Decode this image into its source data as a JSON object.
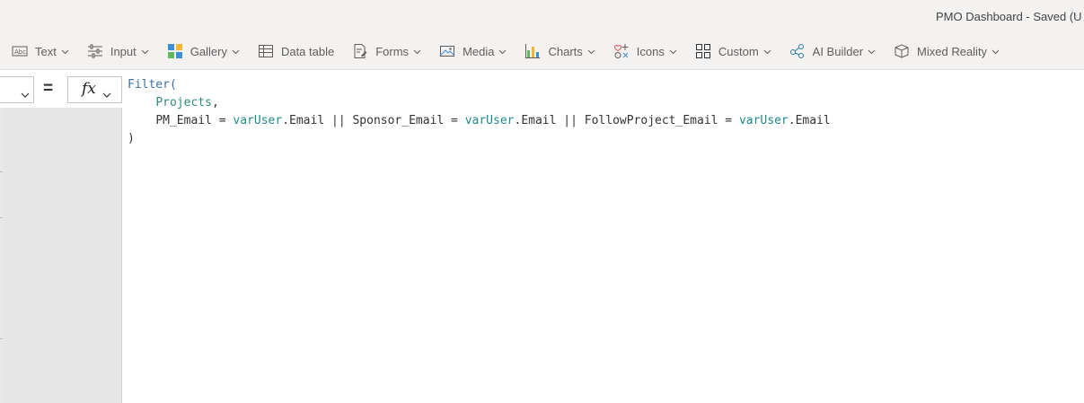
{
  "window": {
    "title": "PMO Dashboard - Saved (U"
  },
  "toolbar": {
    "items": [
      {
        "label": "Text",
        "icon": "text-label-icon"
      },
      {
        "label": "Input",
        "icon": "input-sliders-icon"
      },
      {
        "label": "Gallery",
        "icon": "gallery-icon"
      },
      {
        "label": "Data table",
        "icon": "data-table-icon"
      },
      {
        "label": "Forms",
        "icon": "forms-icon"
      },
      {
        "label": "Media",
        "icon": "media-icon"
      },
      {
        "label": "Charts",
        "icon": "charts-icon"
      },
      {
        "label": "Icons",
        "icon": "icons-icon"
      },
      {
        "label": "Custom",
        "icon": "custom-icon"
      },
      {
        "label": "AI Builder",
        "icon": "ai-builder-icon"
      },
      {
        "label": "Mixed Reality",
        "icon": "mixed-reality-icon"
      }
    ]
  },
  "formula_bar": {
    "equals": "=",
    "fx": "fx",
    "code": {
      "line1_fn": "Filter(",
      "line2_indent": "    ",
      "line2_source": "Projects",
      "line2_comma": ",",
      "line3_indent": "    ",
      "line3_a": "PM_Email = ",
      "line3_var1": "varUser",
      "line3_b": ".Email || Sponsor_Email = ",
      "line3_var2": "varUser",
      "line3_c": ".Email || FollowProject_Email = ",
      "line3_var3": "varUser",
      "line3_d": ".Email",
      "line4": ")"
    }
  },
  "colors": {
    "toolbar_bg": "#f3f2f1",
    "keyword": "#3a70a8",
    "datasource": "#2e8b7a",
    "variable": "#208a8a"
  }
}
